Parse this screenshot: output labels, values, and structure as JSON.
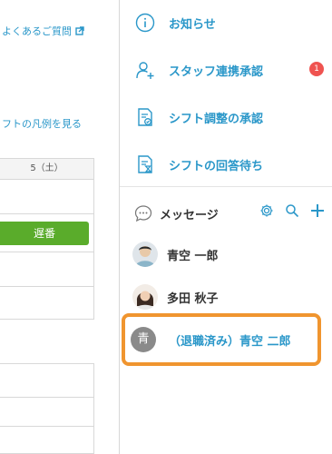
{
  "background_page": {
    "faq_link": "よくあるご質問",
    "legend_link": "フトの凡例を見る",
    "calendar_header": "5（土）",
    "shift_label": "遅番"
  },
  "menu": {
    "items": [
      {
        "label": "お知らせ",
        "icon": "info-icon"
      },
      {
        "label": "スタッフ連携承認",
        "icon": "person-add-icon",
        "badge": "1"
      },
      {
        "label": "シフト調整の承認",
        "icon": "document-check-icon"
      },
      {
        "label": "シフトの回答待ち",
        "icon": "document-hourglass-icon"
      }
    ]
  },
  "messages": {
    "title": "メッセージ",
    "icons": [
      "gear-icon",
      "search-icon",
      "plus-icon"
    ],
    "contacts": [
      {
        "name": "青空 一郎",
        "avatar": "photo"
      },
      {
        "name": "多田 秋子",
        "avatar": "photo"
      },
      {
        "name": "（退職済み）青空 二郎",
        "avatar_letter": "青",
        "highlighted": true
      }
    ]
  },
  "colors": {
    "accent_blue": "#2a97c9",
    "badge_red": "#ef5350",
    "shift_green": "#5aac2b",
    "highlight_orange": "#f0952f"
  }
}
